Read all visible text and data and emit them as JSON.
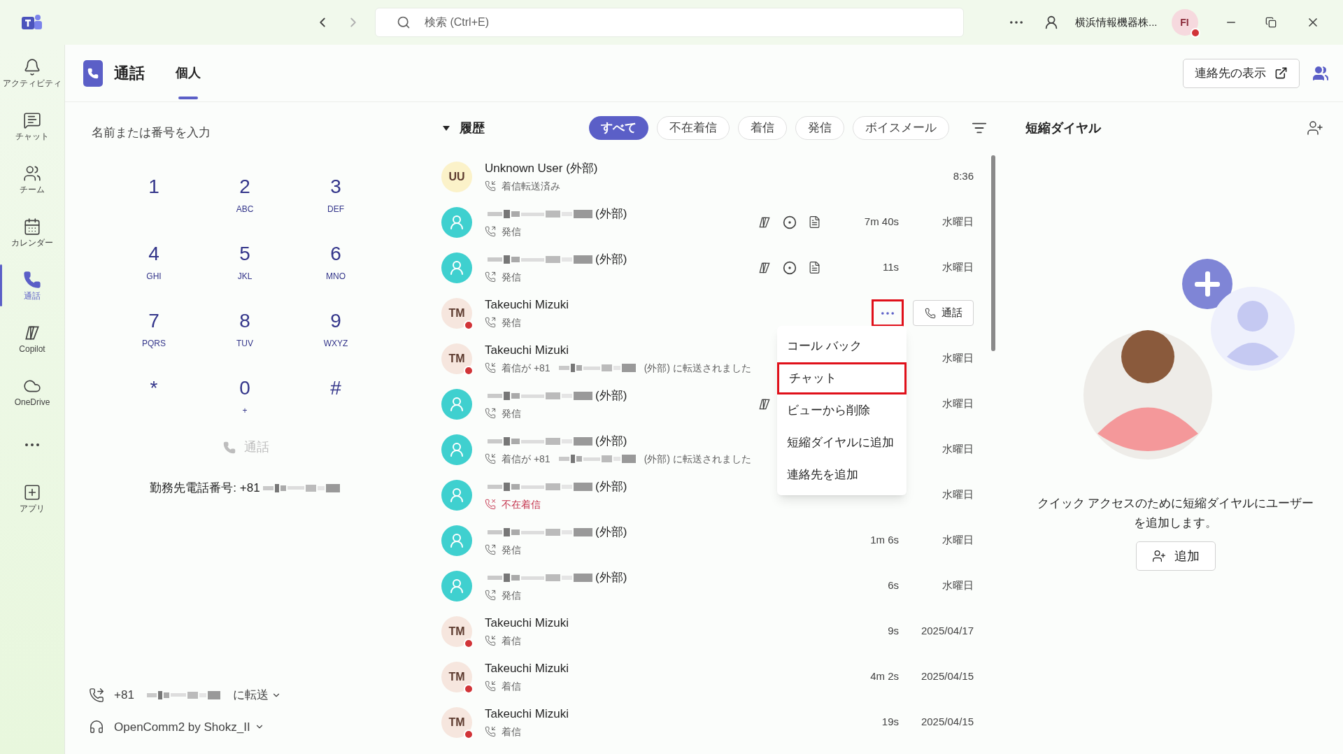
{
  "title_bar": {
    "search_placeholder": "検索 (Ctrl+E)",
    "org": "横浜情報機器株...",
    "avatar": "FI",
    "busy": true
  },
  "rail": [
    {
      "kind": "activity",
      "label": "アクティビティ",
      "selected": false
    },
    {
      "kind": "chat",
      "label": "チャット",
      "selected": false
    },
    {
      "kind": "teams",
      "label": "チーム",
      "selected": false
    },
    {
      "kind": "calendar",
      "label": "カレンダー",
      "selected": false
    },
    {
      "kind": "calls",
      "label": "通話",
      "selected": true
    },
    {
      "kind": "copilot",
      "label": "Copilot",
      "selected": false
    },
    {
      "kind": "onedrive",
      "label": "OneDrive",
      "selected": false
    },
    {
      "kind": "more",
      "selected": false
    },
    {
      "kind": "apps",
      "label": "アプリ",
      "selected": false
    }
  ],
  "header": {
    "title": "通話",
    "tabs": [
      {
        "label": "個人",
        "selected": true
      }
    ],
    "contacts_button": "連絡先の表示"
  },
  "dialer": {
    "placeholder": "名前または番号を入力",
    "keys": [
      {
        "digit": "1"
      },
      {
        "digit": "2",
        "letters": "ABC"
      },
      {
        "digit": "3",
        "letters": "DEF"
      },
      {
        "digit": "4",
        "letters": "GHI"
      },
      {
        "digit": "5",
        "letters": "JKL"
      },
      {
        "digit": "6",
        "letters": "MNO"
      },
      {
        "digit": "7",
        "letters": "PQRS"
      },
      {
        "digit": "8",
        "letters": "TUV"
      },
      {
        "digit": "9",
        "letters": "WXYZ"
      },
      {
        "digit": "*"
      },
      {
        "digit": "0",
        "letters": "+"
      },
      {
        "digit": "#"
      }
    ],
    "call_button": {
      "label": "通話",
      "disabled": true
    },
    "work_number": "勤務先電話番号: +81",
    "forward": {
      "prefix": "+81",
      "suffix": "に転送"
    },
    "device": "OpenComm2 by Shokz_II"
  },
  "history": {
    "title": "履歴",
    "expanded": true,
    "filters": [
      {
        "label": "すべて",
        "selected": true
      },
      {
        "label": "不在着信",
        "selected": false
      },
      {
        "label": "着信",
        "selected": false
      },
      {
        "label": "発信",
        "selected": false
      },
      {
        "label": "ボイスメール",
        "selected": false
      }
    ],
    "rows": [
      {
        "initials": "UU",
        "color": "#fbf2c9",
        "name": "Unknown User (外部)",
        "kind": "incoming",
        "status": "着信転送済み",
        "date": "8:36"
      },
      {
        "color": "#3fd0cf",
        "name_redacted": true,
        "name": "(外部)",
        "kind": "outgoing",
        "status": "発信",
        "copilot": true,
        "recording": true,
        "transcript": true,
        "duration": "7m 40s",
        "date": "水曜日"
      },
      {
        "color": "#3fd0cf",
        "name_redacted": true,
        "name": "(外部)",
        "kind": "outgoing",
        "status": "発信",
        "copilot": true,
        "recording": true,
        "transcript": true,
        "duration": "11s",
        "date": "水曜日"
      },
      {
        "initials": "TM",
        "color": "#f6e6de",
        "busy": true,
        "name": "Takeuchi Mizuki",
        "kind": "outgoing",
        "status": "発信",
        "hovered": true,
        "call_label": "通話"
      },
      {
        "initials": "TM",
        "color": "#f6e6de",
        "busy": true,
        "name": "Takeuchi Mizuki",
        "kind": "incoming",
        "status": "着信が +81",
        "status_redacted": true,
        "status_after": "(外部) に転送されました",
        "date": "水曜日"
      },
      {
        "color": "#3fd0cf",
        "name_redacted": true,
        "name": "(外部)",
        "kind": "outgoing",
        "status": "発信",
        "copilot": true,
        "date": "水曜日"
      },
      {
        "color": "#3fd0cf",
        "name_redacted": true,
        "name": "(外部)",
        "kind": "incoming",
        "status": "着信が +81",
        "status_redacted": true,
        "status_after": "(外部) に転送されました",
        "date": "水曜日"
      },
      {
        "color": "#3fd0cf",
        "name_redacted": true,
        "name": "(外部)",
        "kind": "missed",
        "status": "不在着信",
        "date": "水曜日"
      },
      {
        "color": "#3fd0cf",
        "name_redacted": true,
        "name": "(外部)",
        "kind": "outgoing",
        "status": "発信",
        "duration": "1m 6s",
        "date": "水曜日"
      },
      {
        "color": "#3fd0cf",
        "name_redacted": true,
        "name": "(外部)",
        "kind": "outgoing",
        "status": "発信",
        "duration": "6s",
        "date": "水曜日"
      },
      {
        "initials": "TM",
        "color": "#f6e6de",
        "busy": true,
        "name": "Takeuchi Mizuki",
        "kind": "incoming",
        "status": "着信",
        "duration": "9s",
        "date": "2025/04/17"
      },
      {
        "initials": "TM",
        "color": "#f6e6de",
        "busy": true,
        "name": "Takeuchi Mizuki",
        "kind": "incoming",
        "status": "着信",
        "duration": "4m 2s",
        "date": "2025/04/15"
      },
      {
        "initials": "TM",
        "color": "#f6e6de",
        "busy": true,
        "name": "Takeuchi Mizuki",
        "kind": "incoming",
        "status": "着信",
        "duration": "19s",
        "date": "2025/04/15"
      }
    ],
    "context_menu": {
      "items": [
        {
          "label": "コール バック",
          "highlighted": false
        },
        {
          "label": "チャット",
          "highlighted": true
        },
        {
          "label": "ビューから削除",
          "highlighted": false
        },
        {
          "label": "短縮ダイヤルに追加",
          "highlighted": false
        },
        {
          "label": "連絡先を追加",
          "highlighted": false
        }
      ]
    },
    "more_button_highlighted": true
  },
  "speed_dial": {
    "title": "短縮ダイヤル",
    "message": "クイック アクセスのために短縮ダイヤルにユーザーを追加します。",
    "add_button": "追加"
  }
}
